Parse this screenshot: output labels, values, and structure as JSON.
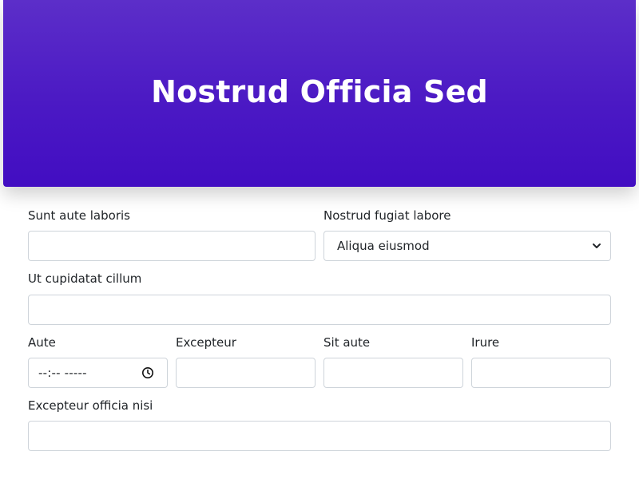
{
  "header": {
    "title": "Nostrud Officia Sed"
  },
  "fields": {
    "row1": {
      "left_label": "Sunt aute laboris",
      "right_label": "Nostrud fugiat labore",
      "right_select_value": "Aliqua eiusmod"
    },
    "row2": {
      "label": "Ut cupidatat cillum"
    },
    "row3": {
      "aute_label": "Aute",
      "aute_time_placeholder": "--:-- -----",
      "excepteur_label": "Excepteur",
      "sit_aute_label": "Sit aute",
      "irure_label": "Irure"
    },
    "row4": {
      "label": "Excepteur officia nisi"
    }
  },
  "colors": {
    "header_gradient_top": "#5c2ec9",
    "header_gradient_bottom": "#420dc2",
    "input_border": "#ced4da",
    "text": "#212529"
  },
  "icons": {
    "select_chevron": "chevron-down-icon",
    "time_clock": "clock-icon"
  }
}
